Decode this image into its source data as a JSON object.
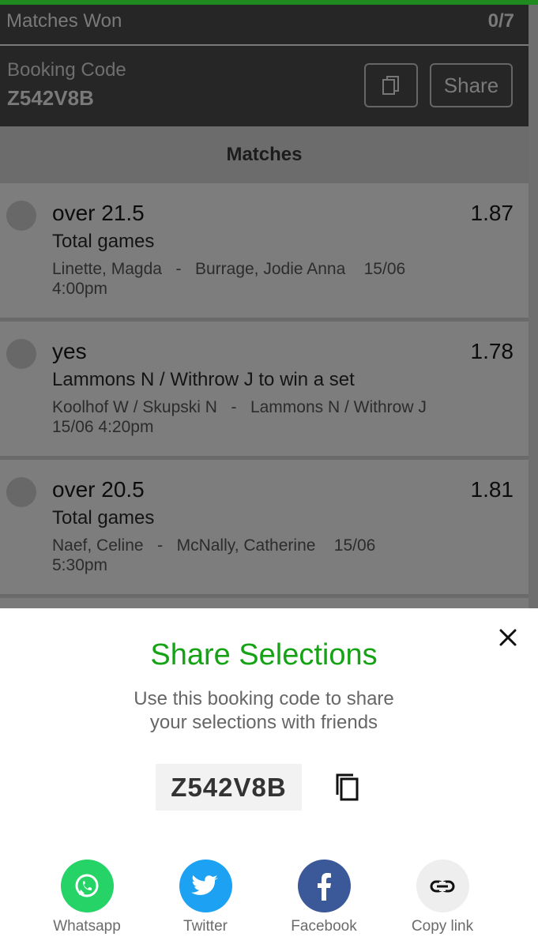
{
  "header": {
    "matches_won_label": "Matches Won",
    "matches_won_value": "0/7",
    "booking_label": "Booking Code",
    "booking_code": "Z542V8B",
    "share_label": "Share"
  },
  "matches_title": "Matches",
  "matches": [
    {
      "pick": "over 21.5",
      "odds": "1.87",
      "market": "Total games",
      "home": "Linette, Magda",
      "sep": "-",
      "away": "Burrage, Jodie Anna",
      "date": "15/06",
      "time": "4:00pm"
    },
    {
      "pick": "yes",
      "odds": "1.78",
      "market": "Lammons N / Withrow J to win a set",
      "home": "Koolhof W / Skupski N",
      "sep": "-",
      "away": "Lammons N / Withrow J",
      "date": "15/06",
      "time": "4:20pm"
    },
    {
      "pick": "over 20.5",
      "odds": "1.81",
      "market": "Total games",
      "home": "Naef, Celine",
      "sep": "-",
      "away": "McNally, Catherine",
      "date": "15/06",
      "time": "5:30pm"
    }
  ],
  "sheet": {
    "title": "Share Selections",
    "desc_line1": "Use this booking code to share",
    "desc_line2": "your selections with friends",
    "code": "Z542V8B",
    "socials": [
      {
        "label": "Whatsapp",
        "icon": "whatsapp-icon",
        "color": "#25D366"
      },
      {
        "label": "Twitter",
        "icon": "twitter-icon",
        "color": "#1DA1F2"
      },
      {
        "label": "Facebook",
        "icon": "facebook-icon",
        "color": "#3B5998"
      },
      {
        "label": "Copy link",
        "icon": "link-icon",
        "color": "#EEEEEE"
      }
    ]
  },
  "colors": {
    "accent": "#1f8a1f",
    "title_green": "#15a315"
  }
}
